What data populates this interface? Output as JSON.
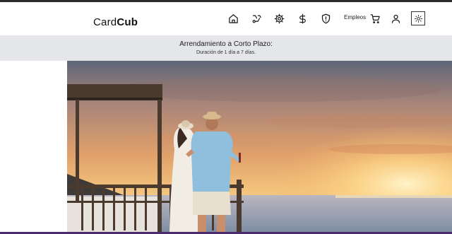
{
  "brand": {
    "light": "Card",
    "bold": "Cub"
  },
  "nav": {
    "icons": [
      "home-icon",
      "delivery-icon",
      "settings-icon",
      "dollar-icon",
      "shield-icon"
    ],
    "jobs_label": "Empleos",
    "cart_icon": "cart-icon",
    "user_icon": "user-icon",
    "theme_icon": "sun-icon"
  },
  "banner": {
    "title": "Arrendamiento a Corto Plazo:",
    "subtitle": "Duración de 1 día a 7 días."
  },
  "hero": {
    "alt": "sunset-couple-balcony"
  },
  "colors": {
    "accent": "#4b2a6e",
    "banner_bg": "#e5e6e9"
  }
}
